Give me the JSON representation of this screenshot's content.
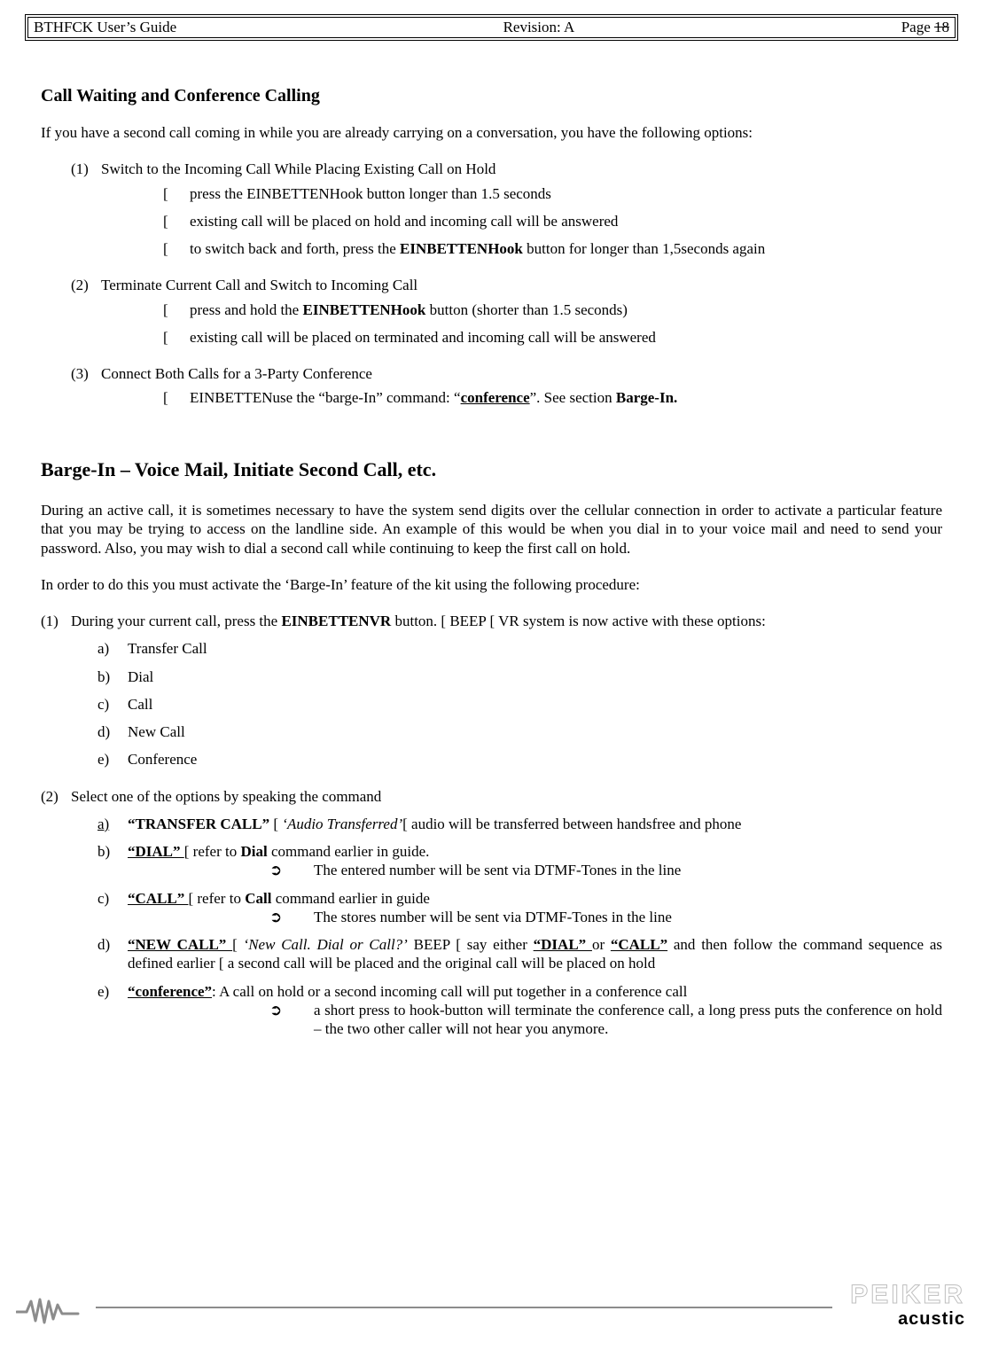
{
  "header": {
    "left": "BTHFCK  User’s Guide",
    "center": "Revision: A",
    "right_prefix": "Page ",
    "right_strike": "18",
    "right_over": "18"
  },
  "section1": {
    "title": "Call Waiting and Conference Calling",
    "intro": "If you have a second call coming in while you are already carrying on a conversation, you have the following options:",
    "items": [
      {
        "num": "(1)",
        "text": "Switch to the Incoming Call While Placing Existing Call on Hold",
        "bullets": [
          {
            "pre": "press the EINBETTENHook button longer than 1.5 seconds"
          },
          {
            "pre": "existing call will be placed on hold and incoming call will be answered"
          },
          {
            "pre": "to switch back and forth, press the ",
            "bold": "EINBETTENHook",
            "post": " button for longer than 1,5seconds again"
          }
        ]
      },
      {
        "num": "(2)",
        "text": "Terminate Current Call and Switch to Incoming Call",
        "bullets": [
          {
            "pre": "press and hold the ",
            "bold": "EINBETTENHook",
            "post": " button (shorter than 1.5 seconds)"
          },
          {
            "pre": "existing call will be placed on terminated and incoming call will be answered"
          }
        ]
      },
      {
        "num": "(3)",
        "text": "Connect Both Calls for a 3-Party Conference",
        "bullets": [
          {
            "pre": "EINBETTENuse the “barge-In” command: “",
            "boldU": "conference",
            "post": "”. See section ",
            "bold2": "Barge-In."
          }
        ]
      }
    ]
  },
  "section2": {
    "title": "Barge-In – Voice Mail, Initiate Second Call, etc.",
    "para1": "During an active call, it is sometimes necessary to have the system send digits over the cellular connection in order to activate a particular feature that you may be trying to access on the landline side.  An example of this would be when you dial in to your voice mail and need to send your password.  Also, you may wish to dial a second call while continuing to keep the first call on hold.",
    "para2": "In order to do this you must activate the ‘Barge-In’ feature of the kit using the following procedure:",
    "step1": {
      "num": "(1)",
      "pre": "During your current call, press the ",
      "bold": "EINBETTENVR",
      "post": " button. [ BEEP [ VR system is now active with these options:",
      "options": [
        {
          "lbl": "a)",
          "text": "Transfer Call"
        },
        {
          "lbl": "b)",
          "text": "Dial"
        },
        {
          "lbl": "c)",
          "text": "Call"
        },
        {
          "lbl": "d)",
          "text": "New Call"
        },
        {
          "lbl": "e)",
          "text": "Conference"
        }
      ]
    },
    "step2": {
      "num": "(2)",
      "text": "Select one of the options by speaking the command",
      "options": {
        "a": {
          "lbl": "a)",
          "cmd": "“TRANSFER CALL”",
          "mid": " [ ",
          "italic": "‘Audio Transferred’",
          "post": "[ audio will be transferred between handsfree and phone",
          "lbl_underline": true
        },
        "b": {
          "lbl": "b)",
          "cmd": "“DIAL” ",
          "mid": "[ refer to ",
          "bold": "Dial",
          "post": " command earlier in guide.",
          "note": "The entered number will be sent via DTMF-Tones in the line"
        },
        "c": {
          "lbl": "c)",
          "cmd": "“CALL” ",
          "mid": "[ refer to ",
          "bold": "Call",
          "post": " command earlier in guide",
          "note": "The stores number will be sent via DTMF-Tones in the line"
        },
        "d": {
          "lbl": "d)",
          "cmd": "“NEW CALL” ",
          "mid": "[ ",
          "italic": "‘New Call. Dial or Call?’",
          "post1": " BEEP [ say either ",
          "cmd2": "“DIAL” ",
          "post2": "or ",
          "cmd3": "“CALL”",
          "post3": " and then follow the command sequence as defined earlier [ a second call will be placed and the original call will be placed on hold"
        },
        "e": {
          "lbl": "e)",
          "cmd": "“conference”",
          "post": ": A call on hold or a second incoming call will put together in a conference call",
          "note": "a short press to hook-button will terminate the conference call, a long press puts the conference on hold – the two other caller will not hear you anymore."
        }
      }
    }
  },
  "footer": {
    "brand": "PEIKER",
    "sub": "acustic"
  },
  "arrow": "➲"
}
